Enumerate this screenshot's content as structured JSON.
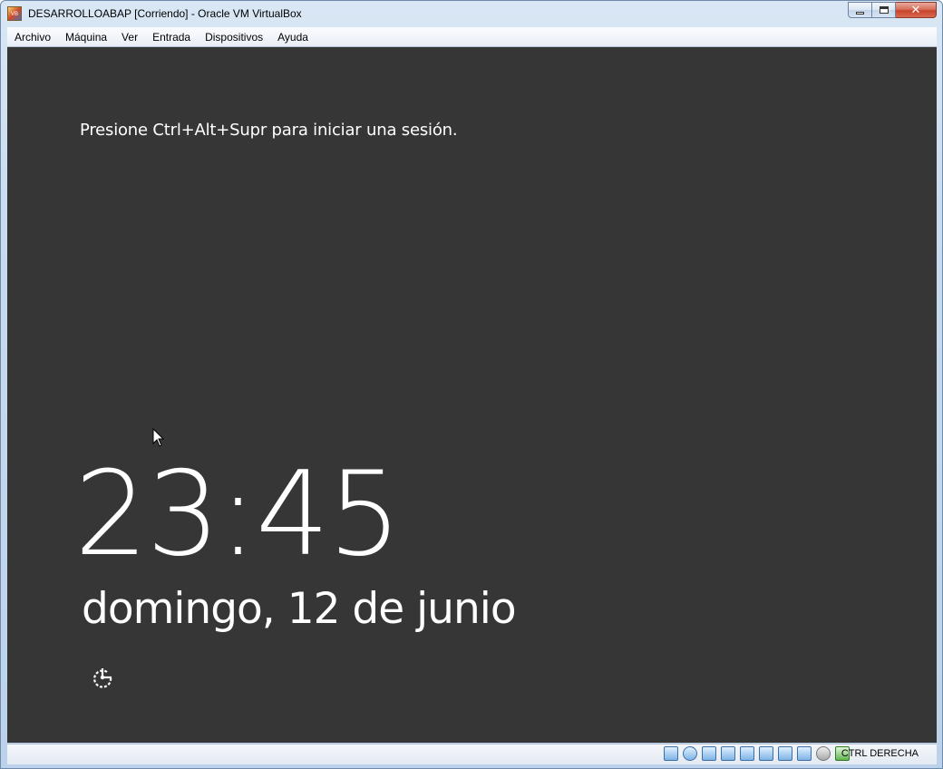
{
  "window": {
    "title": "DESARROLLOABAP [Corriendo] - Oracle VM VirtualBox",
    "app_icon": "virtualbox-icon",
    "buttons": {
      "minimize": "minimize-icon",
      "maximize": "maximize-icon",
      "close_glyph": "✕"
    }
  },
  "menubar": {
    "items": [
      "Archivo",
      "Máquina",
      "Ver",
      "Entrada",
      "Dispositivos",
      "Ayuda"
    ]
  },
  "lockscreen": {
    "prompt": "Presione Ctrl+Alt+Supr para iniciar una sesión.",
    "time": "23:45",
    "date": "domingo, 12 de junio",
    "ease_of_access_icon": "ease-of-access-icon",
    "background_color": "#363636",
    "text_color": "#ffffff"
  },
  "statusbar": {
    "icons": [
      "hard-disk-icon",
      "optical-drive-icon",
      "network-icon",
      "usb-icon",
      "shared-folders-icon",
      "display-icon",
      "video-capture-icon",
      "cpu-virtualization-icon",
      "mouse-integration-icon",
      "keyboard-capture-icon"
    ],
    "host_key": "CTRL DERECHA"
  }
}
